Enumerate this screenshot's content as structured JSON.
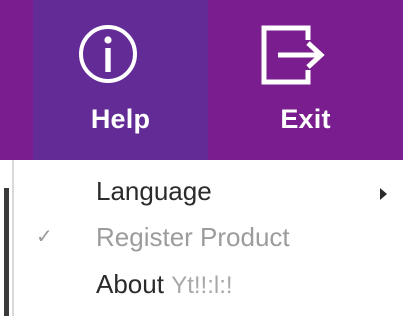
{
  "toolbar": {
    "help": {
      "label": "Help",
      "icon": "info-icon"
    },
    "exit": {
      "label": "Exit",
      "icon": "exit-icon"
    },
    "colors": {
      "bar": "#7a1e8f",
      "help_bg": "#622b96",
      "text": "#ffffff"
    }
  },
  "menu": {
    "items": [
      {
        "label": "Language",
        "has_submenu": true,
        "enabled": true
      },
      {
        "label": "Register Product",
        "checked": true,
        "enabled": false
      },
      {
        "label": "About",
        "app_name": "Yt!!:l:!",
        "enabled": true
      }
    ]
  }
}
